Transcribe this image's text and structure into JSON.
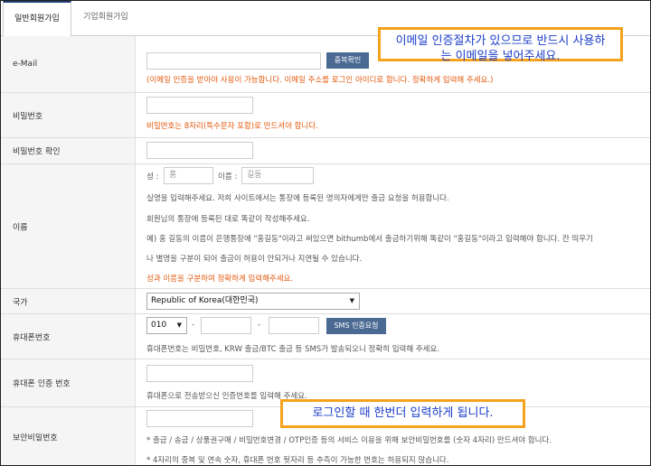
{
  "tabs": {
    "personal": "일반회원가입",
    "business": "기업회원가입"
  },
  "email": {
    "label": "e-Mail",
    "button": "중복확인",
    "note": "(이메일 인증을 받아야 사용이 가능합니다. 이메일 주소를 로그인 아이디로 합니다. 정확하게 입력해 주세요.)"
  },
  "password": {
    "label": "비밀번호",
    "note": "비밀번호는 8자리(특수문자 포함)로 만드셔야 합니다."
  },
  "password_confirm": {
    "label": "비밀번호 확인"
  },
  "name": {
    "label": "이름",
    "last_label": "성 :",
    "last_placeholder": "홍",
    "first_label": "이름 :",
    "first_placeholder": "길동",
    "note1": "실명을 입력해주세요. 저희 사이트에서는 통장에 등록된 명의자에게만 출금 요청을 허용합니다.",
    "note2": "회원님의 통장에 등록된 대로 똑같이 작성해주세요.",
    "note3": "예) 홍 길동의 이름이 은행통장에 \"홍길동\"이라고 써있으면 bithumb에서 출금하기위해 똑같이 \"홍길동\"이라고 입력해야 합니다. 칸 띄우기",
    "note4": "나 별명을 구분이 되어 출금이 허용이 안되거나 지연될 수 있습니다.",
    "note5": "성과 이름을 구분하여 정확하게 입력해주세요."
  },
  "country": {
    "label": "국가",
    "value": "Republic of Korea(대한민국)",
    "arrow": "▼"
  },
  "phone": {
    "label": "휴대폰번호",
    "prefix": "010",
    "prefix_arrow": "▼",
    "dash": "-",
    "button": "SMS 인증요청",
    "note": "휴대폰번호는 비밀번호, KRW 출금/BTC 출금 등 SMS가 발송되오니 정확히 입력해 주세요."
  },
  "phone_auth": {
    "label": "휴대폰 인증 번호",
    "note": "휴대폰으로 전송받으신 인증번호를 입력해 주세요."
  },
  "security_pw": {
    "label": "보안비밀번호",
    "note1": "* 출금 / 송금 / 상품권구매 / 비밀번호변경 / OTP인증 등의 서비스 이용을 위해 보안비밀번호를 (숫자 4자리) 만드셔야 합니다.",
    "note2": "* 4자리의 중복 및 연속 숫자, 휴대폰 번호 뒷자리 등 추측이 가능한 번호는 허용되지 않습니다."
  },
  "callouts": {
    "top_line1": "이메일 인증절차가 있으므로 반드시 사용하",
    "top_line2": "는 이메일을 넣어주세요.",
    "bottom": "로그인할 때 한번더 입력하게 됩니다."
  },
  "colors": {
    "accent": "#4b6a93",
    "note": "#e45a0f",
    "callout_border": "#f5a21c",
    "callout_text": "#1a3cc8"
  }
}
